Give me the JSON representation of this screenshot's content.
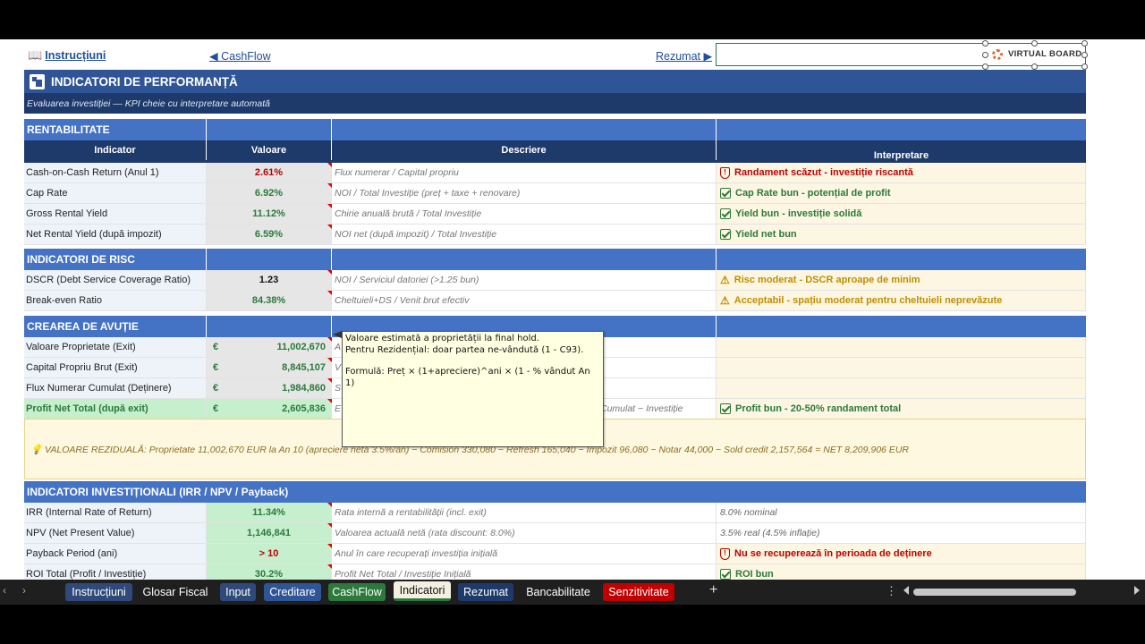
{
  "nav": {
    "instructions": "Instrucțiuni",
    "cashflow": "◀ CashFlow",
    "summary": "Rezumat ▶",
    "logo": "VIRTUAL BOARD"
  },
  "title": "INDICATORI DE PERFORMANȚĂ",
  "subtitle": "Evaluarea investiției — KPI cheie cu interpretare automată",
  "headers": {
    "indicator": "Indicator",
    "value": "Valoare",
    "description": "Descriere",
    "interpretation": "Interpretare"
  },
  "sections": {
    "rentabilitate": "RENTABILITATE",
    "risc": "INDICATORI DE RISC",
    "avutie": "CREAREA DE AVUȚIE",
    "invest": "INDICATORI INVESTIȚIONALI (IRR / NPV / Payback)"
  },
  "rentabilitate": [
    {
      "name": "Cash-on-Cash Return (Anul 1)",
      "value": "2.61%",
      "desc": "Flux numerar / Capital propriu",
      "interp": "Randament scăzut - investiție riscantă",
      "status": "bad"
    },
    {
      "name": "Cap Rate",
      "value": "6.92%",
      "desc": "NOI / Total Investiție (preț + taxe + renovare)",
      "interp": "Cap Rate bun - potențial de profit",
      "status": "ok"
    },
    {
      "name": "Gross Rental Yield",
      "value": "11.12%",
      "desc": "Chirie anuală brută / Total Investiție",
      "interp": "Yield bun - investiție solidă",
      "status": "ok"
    },
    {
      "name": "Net Rental Yield (după impozit)",
      "value": "6.59%",
      "desc": "NOI net (după impozit) / Total Investiție",
      "interp": "Yield net bun",
      "status": "ok"
    }
  ],
  "risc": [
    {
      "name": "DSCR (Debt Service Coverage Ratio)",
      "value": "1.23",
      "desc": "NOI / Serviciul datoriei (>1.25 bun)",
      "interp": "Risc moderat - DSCR aproape de minim",
      "status": "warn"
    },
    {
      "name": "Break-even Ratio",
      "value": "84.38%",
      "desc": "Cheltuieli+DS / Venit brut efectiv",
      "interp": "Acceptabil - spațiu moderat pentru cheltuieli neprevăzute",
      "status": "warn"
    }
  ],
  "avutie": [
    {
      "name": "Valoare Proprietate (Exit)",
      "currency": "€",
      "value": "11,002,670",
      "desc": "A",
      "interp": ""
    },
    {
      "name": "Capital Propriu Brut (Exit)",
      "currency": "€",
      "value": "8,845,107",
      "desc": "V",
      "interp": ""
    },
    {
      "name": "Flux Numerar Cumulat (Deținere)",
      "currency": "€",
      "value": "1,984,860",
      "desc": "S",
      "interp": ""
    },
    {
      "name": "Profit Net Total (după exit)",
      "currency": "€",
      "value": "2,605,836",
      "desc": "E",
      "desc2": "Cumulat − Investiție",
      "interp": "Profit bun - 20-50% randament total"
    }
  ],
  "note": "💡 VALOARE REZIDUALĂ: Proprietate 11,002,670 EUR la An 10 (apreciere netă 3.5%/an) − Comision 330,080 − Refresh 165,040 − Impozit 96,080 − Notar 44,000 − Sold credit 2,157,564 = NET 8,209,906 EUR",
  "invest": [
    {
      "name": "IRR (Internal Rate of Return)",
      "value": "11.34%",
      "desc": "Rata internă a rentabilității (incl. exit)",
      "interp": "8.0% nominal",
      "status": "plain"
    },
    {
      "name": "NPV (Net Present Value)",
      "value": "1,146,841",
      "desc": "Valoarea actuală netă (rata discount: 8.0%)",
      "interp": "3.5% real (4.5% inflație)",
      "status": "plain"
    },
    {
      "name": "Payback Period (ani)",
      "value": "> 10",
      "desc": "Anul în care recuperați investiția inițială",
      "interp": "Nu se recuperează în perioada de deținere",
      "status": "bad"
    },
    {
      "name": "ROI Total (Profit / Investiție)",
      "value": "30.2%",
      "desc": "Profit Net Total / Investiție Inițială",
      "interp": "ROI bun",
      "status": "ok"
    }
  ],
  "tooltip": {
    "line1": "Valoare estimată a proprietății la final hold.",
    "line2": "Pentru Rezidențial: doar partea ne-vândută (1 - C93).",
    "line3": "Formulă: Preț × (1+apreciere)^ani × (1 - % vândut An 1)"
  },
  "tabs": [
    "Instrucțiuni",
    "Glosar Fiscal",
    "Input",
    "Creditare",
    "CashFlow",
    "Indicatori",
    "Rezumat",
    "Bancabilitate",
    "Senzitivitate"
  ],
  "tab_colors": {
    "Instrucțiuni": "#2f4a7a",
    "Glosar Fiscal": "",
    "Input": "#2f4a7a",
    "Creditare": "#2f5597",
    "CashFlow": "#2b7a3b",
    "Indicatori": "active",
    "Rezumat": "#1e3a6a",
    "Bancabilitate": "",
    "Senzitivitate": "#c00000"
  }
}
